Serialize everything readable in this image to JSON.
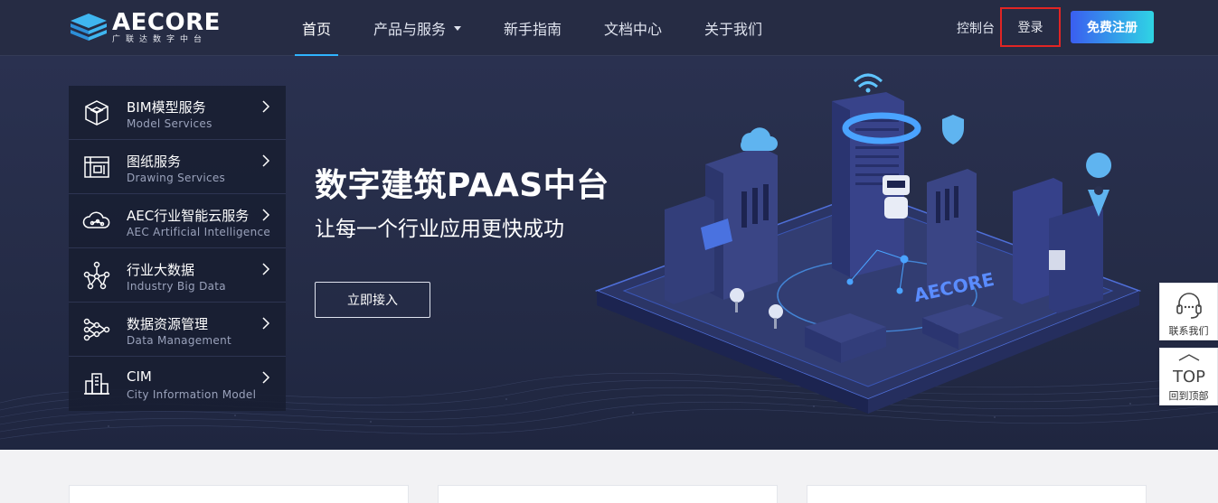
{
  "header": {
    "logo": {
      "name": "AECORE",
      "subtitle": "广联达数字中台"
    },
    "nav": [
      {
        "label": "首页",
        "active": true
      },
      {
        "label": "产品与服务",
        "active": false,
        "dropdown": true
      },
      {
        "label": "新手指南",
        "active": false
      },
      {
        "label": "文档中心",
        "active": false
      },
      {
        "label": "关于我们",
        "active": false
      }
    ],
    "console_label": "控制台",
    "login_label": "登录",
    "register_label": "免费注册"
  },
  "side_menu": [
    {
      "title": "BIM模型服务",
      "subtitle": "Model Services",
      "icon": "cube-icon"
    },
    {
      "title": "图纸服务",
      "subtitle": "Drawing Services",
      "icon": "blueprint-icon"
    },
    {
      "title": "AEC行业智能云服务",
      "subtitle": "AEC Artificial Intelligence",
      "icon": "cloud-network-icon"
    },
    {
      "title": "行业大数据",
      "subtitle": "Industry Big Data",
      "icon": "network-graph-icon"
    },
    {
      "title": "数据资源管理",
      "subtitle": "Data Management",
      "icon": "data-nodes-icon"
    },
    {
      "title": "CIM",
      "subtitle": "City Information Model",
      "icon": "city-icon"
    }
  ],
  "hero": {
    "title": "数字建筑PAAS中台",
    "subtitle": "让每一个行业应用更快成功",
    "cta_label": "立即接入",
    "illustration_text": "AECORE"
  },
  "float_tools": {
    "contact_label": "联系我们",
    "top_label": "回到顶部",
    "top_icon_text": "TOP"
  },
  "colors": {
    "header_bg": "#262c44",
    "hero_bg": "#252c47",
    "accent": "#2fb4ff",
    "login_highlight": "#e12524",
    "register_gradient_start": "#3a5ef0",
    "register_gradient_end": "#2fd4e4"
  }
}
